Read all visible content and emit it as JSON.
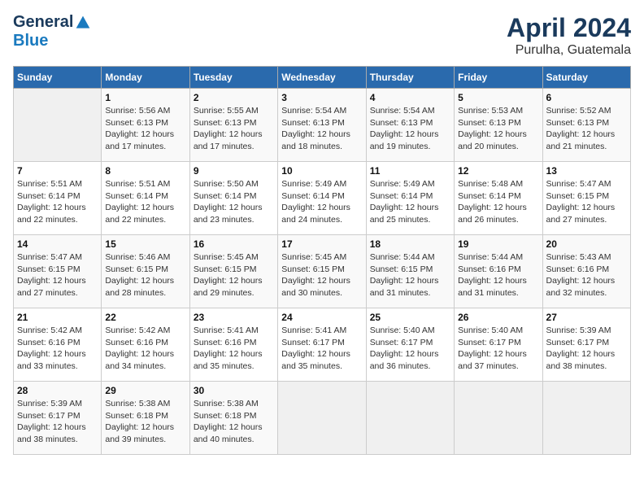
{
  "header": {
    "logo_general": "General",
    "logo_blue": "Blue",
    "title": "April 2024",
    "subtitle": "Purulha, Guatemala"
  },
  "weekdays": [
    "Sunday",
    "Monday",
    "Tuesday",
    "Wednesday",
    "Thursday",
    "Friday",
    "Saturday"
  ],
  "weeks": [
    [
      {
        "day": "",
        "info": ""
      },
      {
        "day": "1",
        "info": "Sunrise: 5:56 AM\nSunset: 6:13 PM\nDaylight: 12 hours\nand 17 minutes."
      },
      {
        "day": "2",
        "info": "Sunrise: 5:55 AM\nSunset: 6:13 PM\nDaylight: 12 hours\nand 17 minutes."
      },
      {
        "day": "3",
        "info": "Sunrise: 5:54 AM\nSunset: 6:13 PM\nDaylight: 12 hours\nand 18 minutes."
      },
      {
        "day": "4",
        "info": "Sunrise: 5:54 AM\nSunset: 6:13 PM\nDaylight: 12 hours\nand 19 minutes."
      },
      {
        "day": "5",
        "info": "Sunrise: 5:53 AM\nSunset: 6:13 PM\nDaylight: 12 hours\nand 20 minutes."
      },
      {
        "day": "6",
        "info": "Sunrise: 5:52 AM\nSunset: 6:13 PM\nDaylight: 12 hours\nand 21 minutes."
      }
    ],
    [
      {
        "day": "7",
        "info": "Sunrise: 5:51 AM\nSunset: 6:14 PM\nDaylight: 12 hours\nand 22 minutes."
      },
      {
        "day": "8",
        "info": "Sunrise: 5:51 AM\nSunset: 6:14 PM\nDaylight: 12 hours\nand 22 minutes."
      },
      {
        "day": "9",
        "info": "Sunrise: 5:50 AM\nSunset: 6:14 PM\nDaylight: 12 hours\nand 23 minutes."
      },
      {
        "day": "10",
        "info": "Sunrise: 5:49 AM\nSunset: 6:14 PM\nDaylight: 12 hours\nand 24 minutes."
      },
      {
        "day": "11",
        "info": "Sunrise: 5:49 AM\nSunset: 6:14 PM\nDaylight: 12 hours\nand 25 minutes."
      },
      {
        "day": "12",
        "info": "Sunrise: 5:48 AM\nSunset: 6:14 PM\nDaylight: 12 hours\nand 26 minutes."
      },
      {
        "day": "13",
        "info": "Sunrise: 5:47 AM\nSunset: 6:15 PM\nDaylight: 12 hours\nand 27 minutes."
      }
    ],
    [
      {
        "day": "14",
        "info": "Sunrise: 5:47 AM\nSunset: 6:15 PM\nDaylight: 12 hours\nand 27 minutes."
      },
      {
        "day": "15",
        "info": "Sunrise: 5:46 AM\nSunset: 6:15 PM\nDaylight: 12 hours\nand 28 minutes."
      },
      {
        "day": "16",
        "info": "Sunrise: 5:45 AM\nSunset: 6:15 PM\nDaylight: 12 hours\nand 29 minutes."
      },
      {
        "day": "17",
        "info": "Sunrise: 5:45 AM\nSunset: 6:15 PM\nDaylight: 12 hours\nand 30 minutes."
      },
      {
        "day": "18",
        "info": "Sunrise: 5:44 AM\nSunset: 6:15 PM\nDaylight: 12 hours\nand 31 minutes."
      },
      {
        "day": "19",
        "info": "Sunrise: 5:44 AM\nSunset: 6:16 PM\nDaylight: 12 hours\nand 31 minutes."
      },
      {
        "day": "20",
        "info": "Sunrise: 5:43 AM\nSunset: 6:16 PM\nDaylight: 12 hours\nand 32 minutes."
      }
    ],
    [
      {
        "day": "21",
        "info": "Sunrise: 5:42 AM\nSunset: 6:16 PM\nDaylight: 12 hours\nand 33 minutes."
      },
      {
        "day": "22",
        "info": "Sunrise: 5:42 AM\nSunset: 6:16 PM\nDaylight: 12 hours\nand 34 minutes."
      },
      {
        "day": "23",
        "info": "Sunrise: 5:41 AM\nSunset: 6:16 PM\nDaylight: 12 hours\nand 35 minutes."
      },
      {
        "day": "24",
        "info": "Sunrise: 5:41 AM\nSunset: 6:17 PM\nDaylight: 12 hours\nand 35 minutes."
      },
      {
        "day": "25",
        "info": "Sunrise: 5:40 AM\nSunset: 6:17 PM\nDaylight: 12 hours\nand 36 minutes."
      },
      {
        "day": "26",
        "info": "Sunrise: 5:40 AM\nSunset: 6:17 PM\nDaylight: 12 hours\nand 37 minutes."
      },
      {
        "day": "27",
        "info": "Sunrise: 5:39 AM\nSunset: 6:17 PM\nDaylight: 12 hours\nand 38 minutes."
      }
    ],
    [
      {
        "day": "28",
        "info": "Sunrise: 5:39 AM\nSunset: 6:17 PM\nDaylight: 12 hours\nand 38 minutes."
      },
      {
        "day": "29",
        "info": "Sunrise: 5:38 AM\nSunset: 6:18 PM\nDaylight: 12 hours\nand 39 minutes."
      },
      {
        "day": "30",
        "info": "Sunrise: 5:38 AM\nSunset: 6:18 PM\nDaylight: 12 hours\nand 40 minutes."
      },
      {
        "day": "",
        "info": ""
      },
      {
        "day": "",
        "info": ""
      },
      {
        "day": "",
        "info": ""
      },
      {
        "day": "",
        "info": ""
      }
    ]
  ]
}
